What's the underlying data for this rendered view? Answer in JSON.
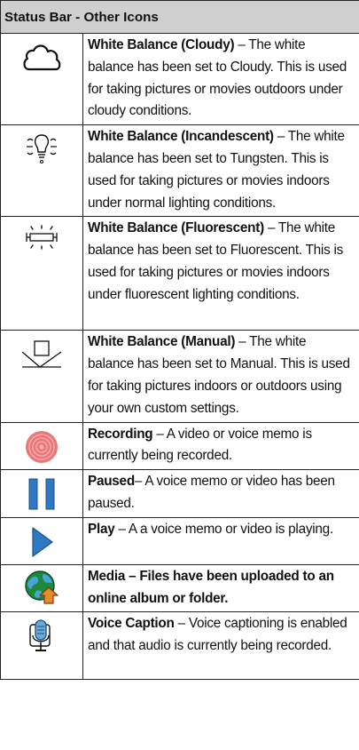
{
  "table": {
    "title": "Status Bar - Other Icons",
    "rows": [
      {
        "icon": "cloud-icon",
        "name": "White Balance (Cloudy)",
        "text": " – The white balance has been set to Cloudy. This is used for taking pictures or movies outdoors under cloudy conditions."
      },
      {
        "icon": "incandescent-bulb-icon",
        "name": "White Balance (Incandescent)",
        "text": " – The white balance has been set to Tungsten. This is used for taking pictures or movies indoors under normal lighting conditions."
      },
      {
        "icon": "fluorescent-tube-icon",
        "name": "White Balance (Fluorescent)",
        "text": " – The white balance has been set to Fluorescent. This is used for taking pictures or movies indoors under fluorescent lighting conditions."
      },
      {
        "icon": "manual-white-balance-icon",
        "name": "White Balance (Manual)",
        "text": " – The white balance has been set to Manual. This is used for taking pictures indoors or outdoors using your own custom settings."
      },
      {
        "icon": "recording-icon",
        "name": "Recording",
        "text": " – A video or voice memo is currently being recorded."
      },
      {
        "icon": "pause-icon",
        "name": "Paused",
        "text": "– A voice memo or video has been paused."
      },
      {
        "icon": "play-icon",
        "name": "Play",
        "text": " – A a voice memo or video is playing."
      },
      {
        "icon": "media-upload-icon",
        "name": "Media – Files have been uploaded to an online album or folder.",
        "text": ""
      },
      {
        "icon": "voice-caption-icon",
        "name": "Voice Caption",
        "text": " – Voice captioning is enabled and that audio is currently being recorded."
      }
    ]
  },
  "colors": {
    "header_bg": "#cfcfcf",
    "recording": "#e97979",
    "pause": "#2f79c2",
    "play": "#2f79c2",
    "media_globe": "#1b8a3a",
    "media_arrow": "#e8892a",
    "voice_mic": "#6aa9d8"
  }
}
